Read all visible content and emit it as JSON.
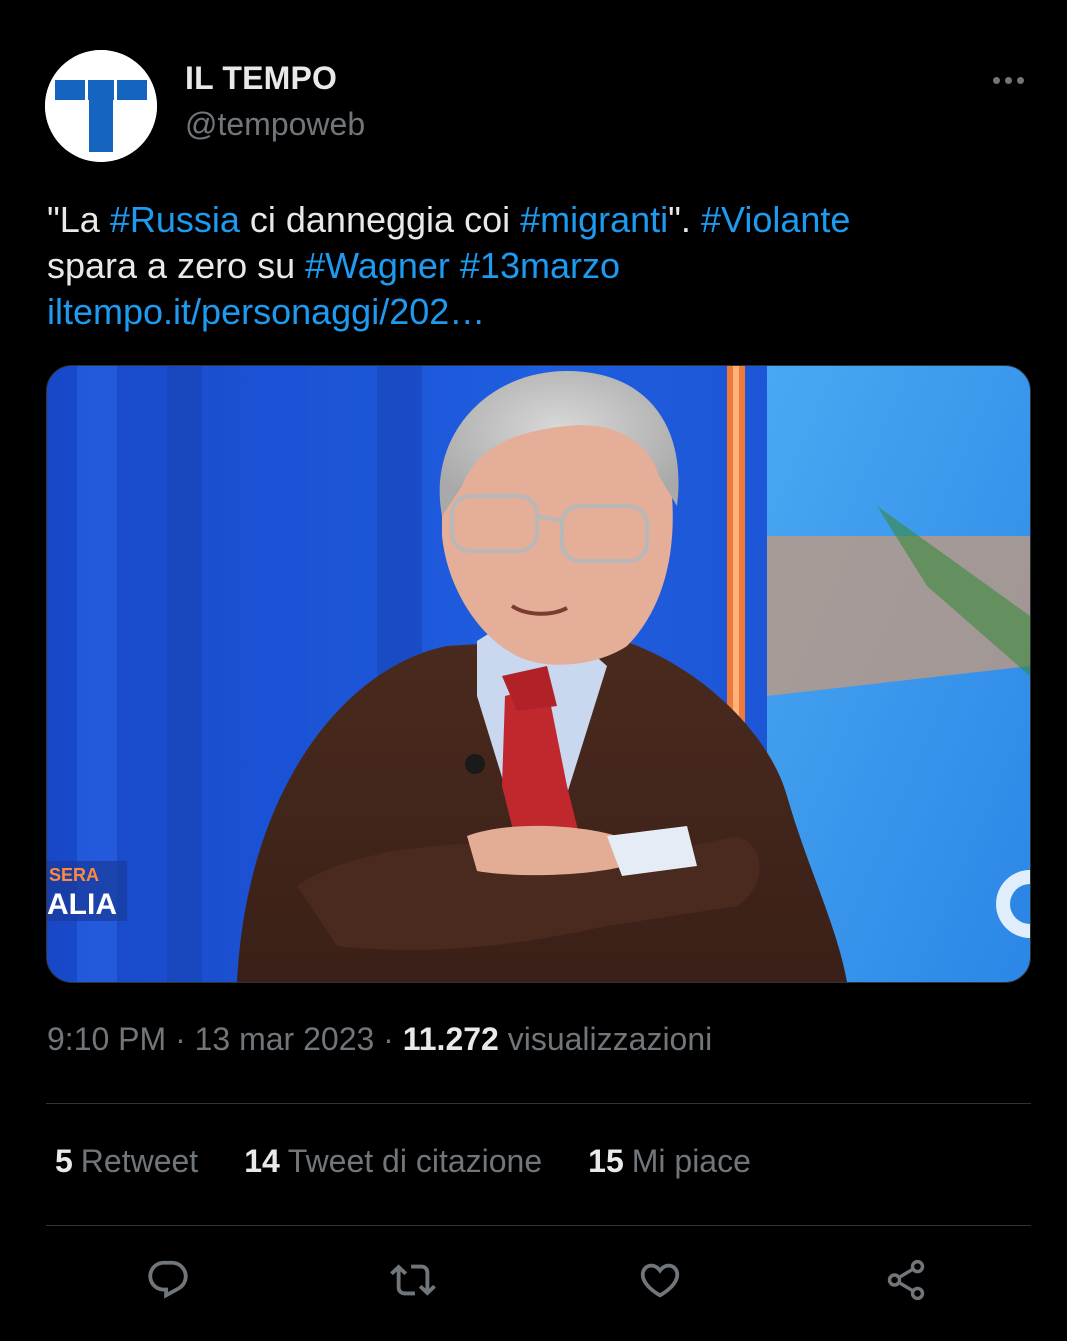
{
  "author": {
    "name": "IL TEMPO",
    "handle": "@tempoweb",
    "avatar_letter": "T"
  },
  "tweet": {
    "text_parts": {
      "t1": "\"La ",
      "h1": "#Russia",
      "t2": " ci danneggia coi ",
      "h2": "#migranti",
      "t3": "\". ",
      "h3": "#Violante",
      "t4": " spara a zero su ",
      "h4": "#Wagner",
      "t5": " ",
      "h5": "#13marzo",
      "link": "iltempo.it/personaggi/202…"
    },
    "media": {
      "overlay_line1": "SERA",
      "overlay_line2": "ALIA"
    }
  },
  "meta": {
    "time": "9:10 PM",
    "sep1": " · ",
    "date": "13 mar 2023",
    "sep2": " · ",
    "views_count": "11.272",
    "views_label": " visualizzazioni"
  },
  "stats": {
    "retweets": {
      "count": "5",
      "label": "Retweet"
    },
    "quotes": {
      "count": "14",
      "label": "Tweet di citazione"
    },
    "likes": {
      "count": "15",
      "label": "Mi piace"
    }
  },
  "actions": {
    "reply": "reply-icon",
    "retweet": "retweet-icon",
    "like": "heart-icon",
    "share": "share-icon"
  },
  "colors": {
    "background": "#000000",
    "text": "#e7e9ea",
    "secondary": "#71767b",
    "link": "#1d9bf0",
    "divider": "#2f3336"
  }
}
